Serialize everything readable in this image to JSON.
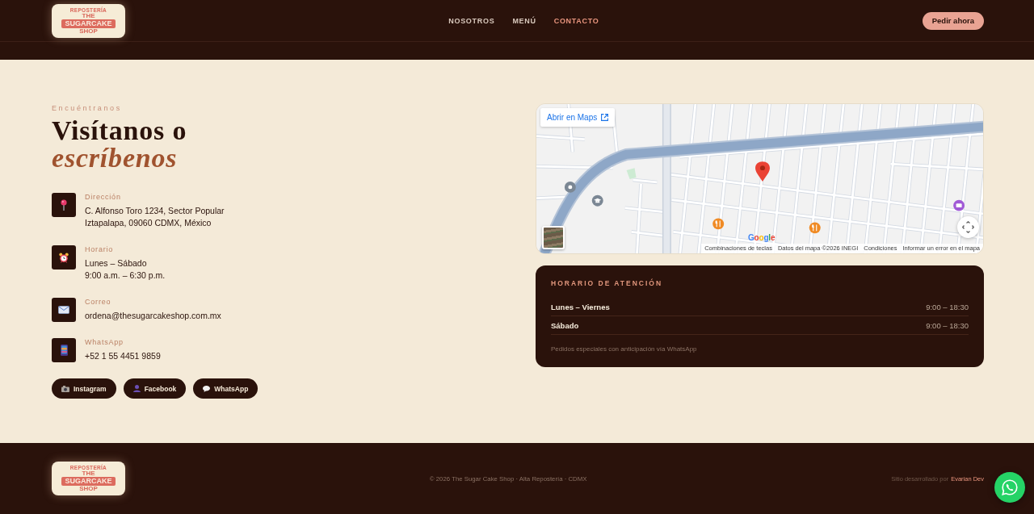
{
  "header": {
    "logo": {
      "tagline": "REPOSTERÍA",
      "lines": [
        "THE",
        "SUGARCAKE",
        "SHOP"
      ]
    },
    "nav": [
      {
        "label": "NOSOTROS",
        "selected": false
      },
      {
        "label": "MENÚ",
        "selected": false
      },
      {
        "label": "CONTACTO",
        "selected": true
      }
    ],
    "cta": "Pedir ahora"
  },
  "contact": {
    "eyebrow": "Encuéntranos",
    "heading": "Visítanos o *escríbenos*",
    "items": [
      {
        "kind": "pin",
        "label": "Dirección",
        "lines": [
          "C. Alfonso Toro 1234, Sector Popular",
          "Iztapalapa, 09060 CDMX, México"
        ]
      },
      {
        "kind": "clock",
        "label": "Horario",
        "lines": [
          "Lunes – Sábado",
          "9:00 a.m. – 6:30 p.m."
        ]
      },
      {
        "kind": "mail",
        "label": "Correo",
        "lines": [
          "ordena@thesugarcakeshop.com.mx"
        ]
      },
      {
        "kind": "phone",
        "label": "WhatsApp",
        "lines": [
          "+52 1 55 4451 9859"
        ]
      }
    ],
    "social": [
      {
        "kind": "camera",
        "label": "Instagram"
      },
      {
        "kind": "person",
        "label": "Facebook"
      },
      {
        "kind": "chat",
        "label": "WhatsApp"
      }
    ]
  },
  "map": {
    "open_link": "Abrir en Maps",
    "logo": "Google",
    "attribution": [
      "Combinaciones de teclas",
      "Datos del mapa ©2026 INEGI",
      "Condiciones",
      "Informar un error en el mapa"
    ]
  },
  "hours": {
    "title": "HORARIO DE ATENCIÓN",
    "rows": [
      {
        "day": "Lunes – Viernes",
        "time": "9:00 – 18:30"
      },
      {
        "day": "Sábado",
        "time": "9:00 – 18:30"
      }
    ],
    "note": "Pedidos especiales con anticipación vía WhatsApp"
  },
  "footer": {
    "logo": {
      "tagline": "REPOSTERÍA",
      "lines": [
        "THE",
        "SUGARCAKE",
        "SHOP"
      ]
    },
    "copyright": "© 2026 The Sugar Cake Shop · Alta Repostería · CDMX",
    "credit": "Sitio desarrollado por",
    "credit_link": "Evarian Dev"
  }
}
